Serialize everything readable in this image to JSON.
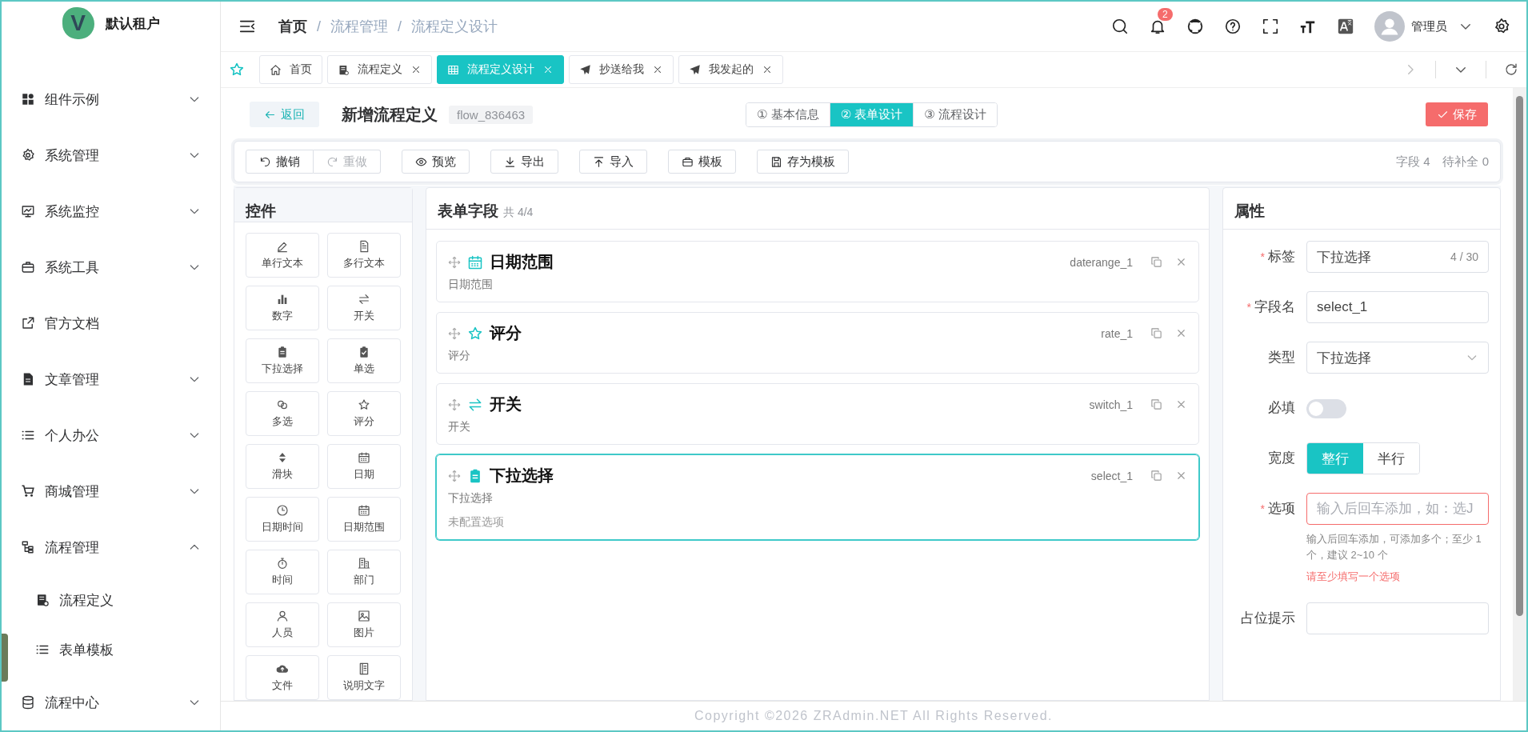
{
  "sidebar": {
    "logo_letter": "V",
    "brand": "默认租户",
    "items": [
      {
        "label": "组件示例",
        "expandable": true,
        "expanded": false
      },
      {
        "label": "系统管理",
        "expandable": true,
        "expanded": false
      },
      {
        "label": "系统监控",
        "expandable": true,
        "expanded": false
      },
      {
        "label": "系统工具",
        "expandable": true,
        "expanded": false
      },
      {
        "label": "官方文档",
        "expandable": false
      },
      {
        "label": "文章管理",
        "expandable": true,
        "expanded": false
      },
      {
        "label": "个人办公",
        "expandable": true,
        "expanded": false
      },
      {
        "label": "商城管理",
        "expandable": true,
        "expanded": false
      },
      {
        "label": "流程管理",
        "expandable": true,
        "expanded": true,
        "children": [
          {
            "label": "流程定义"
          },
          {
            "label": "表单模板"
          }
        ]
      },
      {
        "label": "流程中心",
        "expandable": true,
        "expanded": false
      }
    ]
  },
  "header": {
    "breadcrumbs": [
      {
        "label": "首页"
      },
      {
        "separator": "/",
        "label": "流程管理"
      },
      {
        "separator": "/",
        "label": "流程定义设计"
      }
    ],
    "notification_count": "2",
    "user_name": "管理员"
  },
  "tabs": [
    {
      "label": "首页",
      "closable": false,
      "selected": false
    },
    {
      "label": "流程定义",
      "closable": true,
      "selected": false
    },
    {
      "label": "流程定义设计",
      "closable": true,
      "selected": true
    },
    {
      "label": "抄送给我",
      "closable": true,
      "selected": false
    },
    {
      "label": "我发起的",
      "closable": true,
      "selected": false
    }
  ],
  "page": {
    "back": "返回",
    "title": "新增流程定义",
    "code": "flow_836463",
    "steps": [
      {
        "label": "① 基本信息",
        "selected": false
      },
      {
        "label": "② 表单设计",
        "selected": true
      },
      {
        "label": "③ 流程设计",
        "selected": false
      }
    ],
    "save": "保存"
  },
  "toolbar": {
    "history": [
      {
        "label": "撤销",
        "disabled": false
      },
      {
        "label": "重做",
        "disabled": true
      }
    ],
    "actions": [
      "预览",
      "导出",
      "导入",
      "模板",
      "存为模板"
    ],
    "stats": [
      "字段 4",
      "待补全 0"
    ]
  },
  "palette": {
    "title": "控件",
    "items": [
      "单行文本",
      "多行文本",
      "数字",
      "开关",
      "下拉选择",
      "单选",
      "多选",
      "评分",
      "滑块",
      "日期",
      "日期时间",
      "日期范围",
      "时间",
      "部门",
      "人员",
      "图片",
      "文件",
      "说明文字"
    ]
  },
  "canvas": {
    "title": "表单字段",
    "count": "共 4/4",
    "fields": [
      {
        "kind": "daterange",
        "title": "日期范围",
        "key": "daterange_1",
        "description": "日期范围",
        "selected": false
      },
      {
        "kind": "rate",
        "title": "评分",
        "key": "rate_1",
        "description": "评分",
        "selected": false
      },
      {
        "kind": "switch",
        "title": "开关",
        "key": "switch_1",
        "description": "开关",
        "selected": false
      },
      {
        "kind": "select",
        "title": "下拉选择",
        "key": "select_1",
        "description": "下拉选择",
        "note": "未配置选项",
        "selected": true
      }
    ]
  },
  "properties": {
    "title": "属性",
    "rows": [
      {
        "kind": "input",
        "required_mark": "*",
        "label": "标签",
        "value": "下拉选择",
        "counter": "4 / 30"
      },
      {
        "kind": "input",
        "required_mark": "*",
        "label": "字段名",
        "value": "select_1"
      },
      {
        "kind": "select",
        "label": "类型",
        "value": "下拉选择"
      },
      {
        "kind": "switch",
        "label": "必填",
        "on": false
      },
      {
        "kind": "segmented",
        "label": "宽度",
        "options": [
          {
            "label": "整行",
            "selected": true
          },
          {
            "label": "半行",
            "selected": false
          }
        ]
      },
      {
        "kind": "tags",
        "required_mark": "*",
        "label": "选项",
        "placeholder": "输入后回车添加，如：选J",
        "invalid": true,
        "help": "输入后回车添加，可添加多个；至少 1 个，建议 2~10 个",
        "error": "请至少填写一个选项"
      },
      {
        "kind": "input",
        "label": "占位提示"
      }
    ]
  },
  "footer": "Copyright ©2026 ZRAdmin.NET All Rights Reserved."
}
